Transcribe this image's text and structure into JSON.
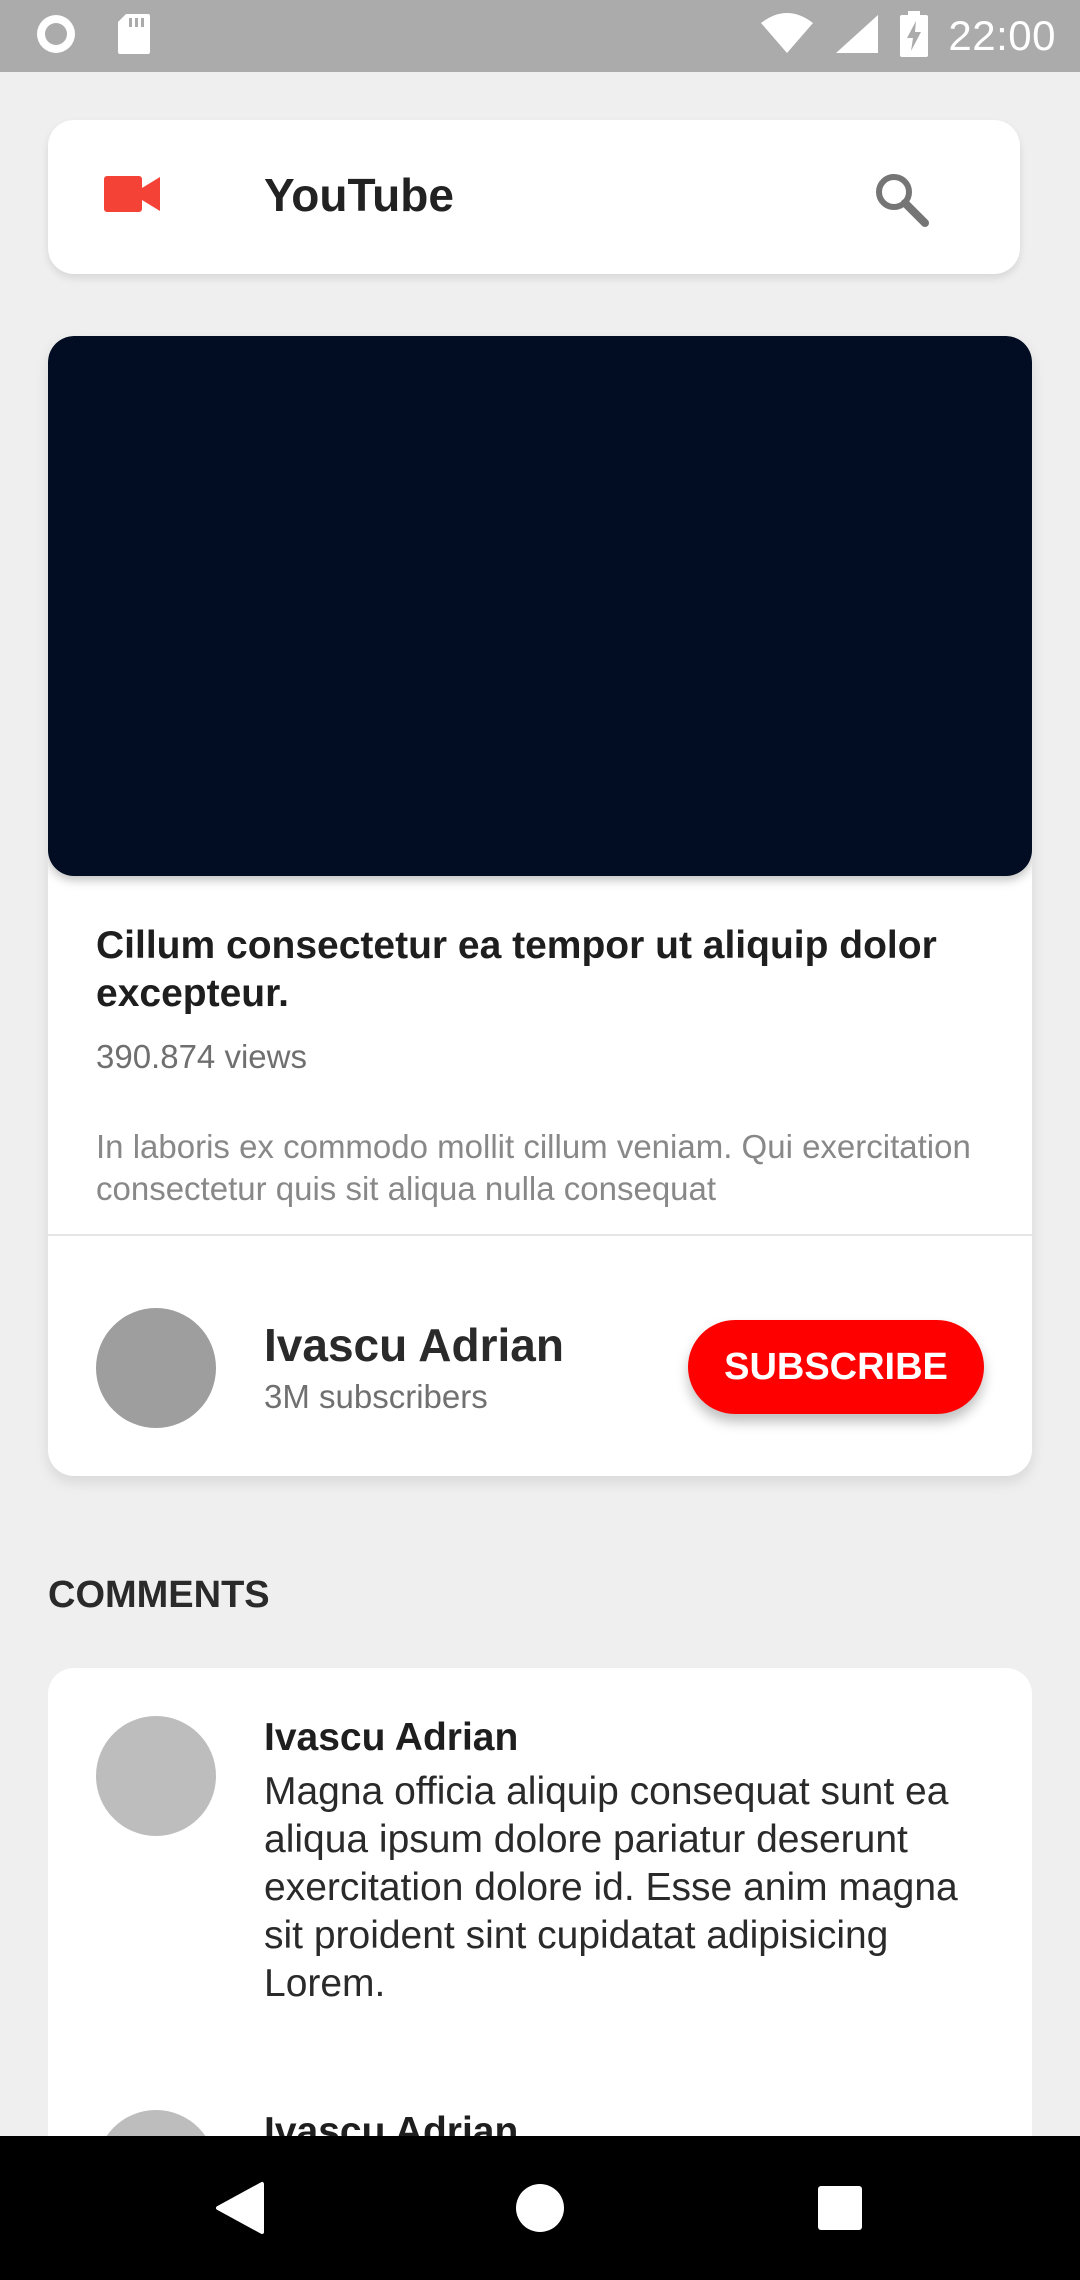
{
  "status_bar": {
    "time": "22:00",
    "icons": [
      "record-icon",
      "sd-card-icon",
      "wifi-icon",
      "signal-icon",
      "battery-charging-icon"
    ]
  },
  "app_bar": {
    "title": "YouTube",
    "logo_icon": "video-camera-icon",
    "search_icon": "search-icon",
    "accent_color": "#f44336"
  },
  "video": {
    "title": "Cillum consectetur ea tempor ut aliquip dolor excepteur.",
    "views": "390.874 views",
    "description": "In laboris ex commodo mollit cillum veniam. Qui exercitation consectetur quis sit aliqua nulla consequat",
    "player_color": "#020d24"
  },
  "channel": {
    "name": "Ivascu Adrian",
    "subscribers": "3M subscribers",
    "subscribe_label": "SUBSCRIBE",
    "subscribe_color": "#ff0000"
  },
  "comments": {
    "heading": "COMMENTS",
    "items": [
      {
        "author": "Ivascu Adrian",
        "text": "Magna officia aliquip consequat sunt ea aliqua ipsum dolore pariatur deserunt exercitation dolore id. Esse anim magna sit proident sint cupidatat adipisicing Lorem."
      },
      {
        "author": "Ivascu Adrian",
        "text": ""
      }
    ]
  },
  "nav_bar": {
    "icons": [
      "back-icon",
      "home-icon",
      "recents-icon"
    ]
  }
}
